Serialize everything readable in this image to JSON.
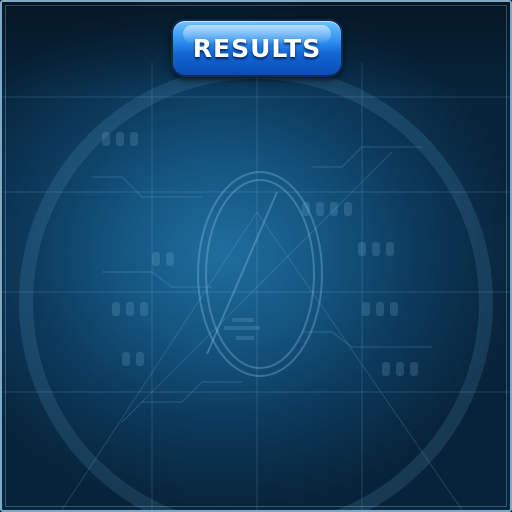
{
  "header": {
    "results_label": "RESULTS"
  },
  "background": {
    "icon": "circuit-board-pattern"
  },
  "colors": {
    "button_top": "#6fc3ff",
    "button_bottom": "#0a4db5",
    "background_center": "#1f6e9e",
    "background_edge": "#072339",
    "frame_border": "#7fa8c4"
  }
}
